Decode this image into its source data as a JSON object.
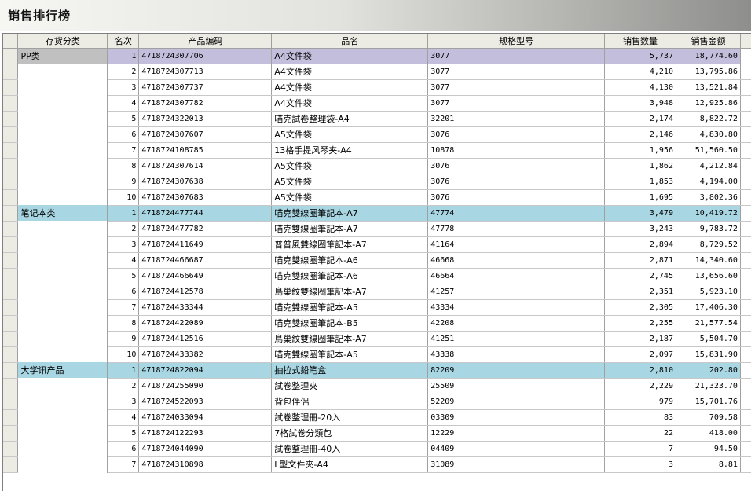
{
  "window": {
    "title": "销售排行榜"
  },
  "table": {
    "columns": [
      "存货分类",
      "名次",
      "产品编码",
      "品名",
      "规格型号",
      "销售数量",
      "销售金额"
    ],
    "groups": [
      {
        "category": "PP类",
        "highlight": "purple",
        "rows": [
          [
            "1",
            "4718724307706",
            "A4文件袋",
            "3077",
            "5,737",
            "18,774.60"
          ],
          [
            "2",
            "4718724307713",
            "A4文件袋",
            "3077",
            "4,210",
            "13,795.86"
          ],
          [
            "3",
            "4718724307737",
            "A4文件袋",
            "3077",
            "4,130",
            "13,521.84"
          ],
          [
            "4",
            "4718724307782",
            "A4文件袋",
            "3077",
            "3,948",
            "12,925.86"
          ],
          [
            "5",
            "4718724322013",
            "喵克試卷整理袋-A4",
            "32201",
            "2,174",
            "8,822.72"
          ],
          [
            "6",
            "4718724307607",
            "A5文件袋",
            "3076",
            "2,146",
            "4,830.80"
          ],
          [
            "7",
            "4718724108785",
            "13格手提风琴夹-A4",
            "10878",
            "1,956",
            "51,560.50"
          ],
          [
            "8",
            "4718724307614",
            "A5文件袋",
            "3076",
            "1,862",
            "4,212.84"
          ],
          [
            "9",
            "4718724307638",
            "A5文件袋",
            "3076",
            "1,853",
            "4,194.00"
          ],
          [
            "10",
            "4718724307683",
            "A5文件袋",
            "3076",
            "1,695",
            "3,802.36"
          ]
        ]
      },
      {
        "category": "笔记本类",
        "highlight": "blue",
        "rows": [
          [
            "1",
            "4718724477744",
            "喵克雙線圈筆記本-A7",
            "47774",
            "3,479",
            "10,419.72"
          ],
          [
            "2",
            "4718724477782",
            "喵克雙線圈筆記本-A7",
            "47778",
            "3,243",
            "9,783.72"
          ],
          [
            "3",
            "4718724411649",
            "普普風雙線圈筆記本-A7",
            "41164",
            "2,894",
            "8,729.52"
          ],
          [
            "4",
            "4718724466687",
            "喵克雙線圈筆記本-A6",
            "46668",
            "2,871",
            "14,340.60"
          ],
          [
            "5",
            "4718724466649",
            "喵克雙線圈筆記本-A6",
            "46664",
            "2,745",
            "13,656.60"
          ],
          [
            "6",
            "4718724412578",
            "鳥巢紋雙線圈筆記本-A7",
            "41257",
            "2,351",
            "5,923.10"
          ],
          [
            "7",
            "4718724433344",
            "喵克雙線圈筆記本-A5",
            "43334",
            "2,305",
            "17,406.30"
          ],
          [
            "8",
            "4718724422089",
            "喵克雙線圈筆記本-B5",
            "42208",
            "2,255",
            "21,577.54"
          ],
          [
            "9",
            "4718724412516",
            "鳥巢紋雙線圈筆記本-A7",
            "41251",
            "2,187",
            "5,504.70"
          ],
          [
            "10",
            "4718724433382",
            "喵克雙線圈筆記本-A5",
            "43338",
            "2,097",
            "15,831.90"
          ]
        ]
      },
      {
        "category": "大学讯产品",
        "highlight": "blue",
        "rows": [
          [
            "1",
            "4718724822094",
            "抽拉式鉛笔盒",
            "82209",
            "2,810",
            "202.80"
          ],
          [
            "2",
            "4718724255090",
            "試卷整理夾",
            "25509",
            "2,229",
            "21,323.70"
          ],
          [
            "3",
            "4718724522093",
            "背包伴侶",
            "52209",
            "979",
            "15,701.76"
          ],
          [
            "4",
            "4718724033094",
            "試卷整理冊-20入",
            "03309",
            "83",
            "709.58"
          ],
          [
            "5",
            "4718724122293",
            "7格試卷分類包",
            "12229",
            "22",
            "418.00"
          ],
          [
            "6",
            "4718724044090",
            "試卷整理冊-40入",
            "04409",
            "7",
            "94.50"
          ],
          [
            "7",
            "4718724310898",
            "L型文件夾-A4",
            "31089",
            "3",
            "8.81"
          ]
        ]
      }
    ]
  }
}
